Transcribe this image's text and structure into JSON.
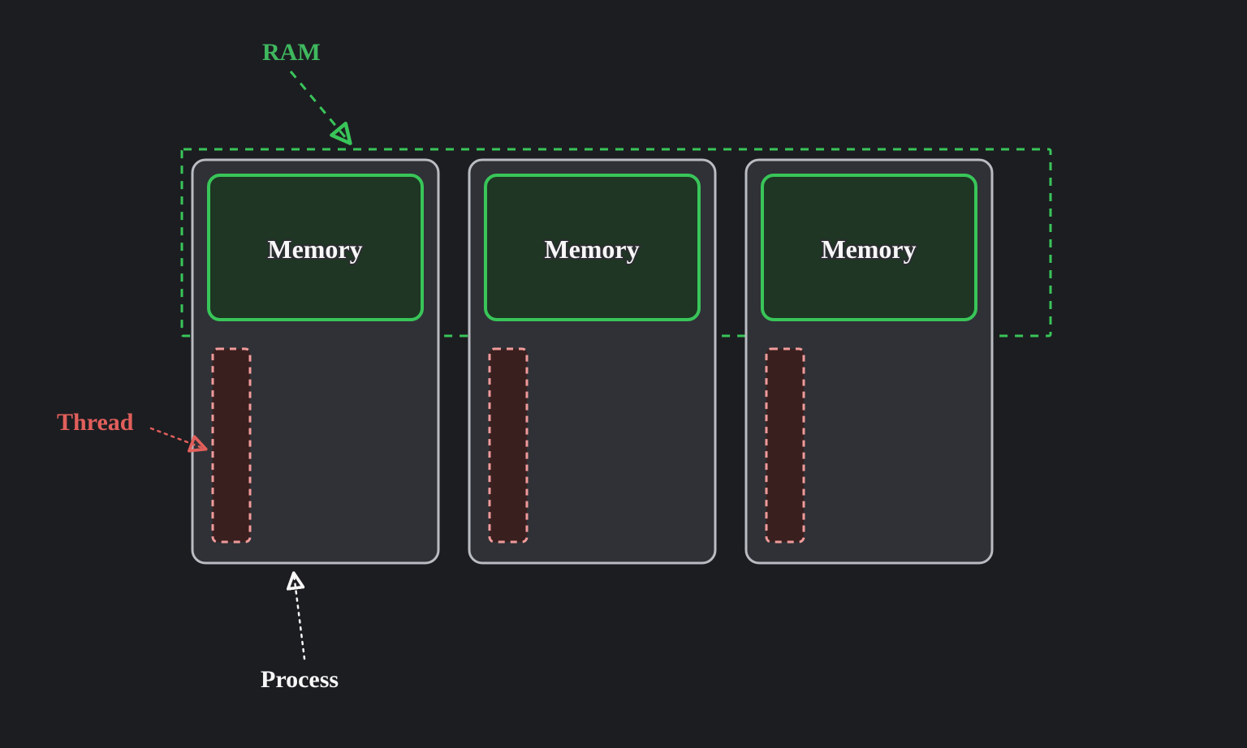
{
  "colors": {
    "bg": "#1c1d21",
    "processFill": "#2f3136",
    "processStroke": "#b9bcc2",
    "memoryFill": "#1e3623",
    "memoryStroke": "#39c559",
    "threadFill": "#3a1f1f",
    "threadStroke": "#f09a9a",
    "ramStroke": "#39c559",
    "ramLabel": "#3fb85e",
    "threadLabel": "#e15f5b",
    "processLabel": "#f7f7f7",
    "memoryLabel": "#f7f7f7"
  },
  "labels": {
    "ram": "RAM",
    "thread": "Thread",
    "process": "Process",
    "memory": "Memory"
  },
  "chart_data": {
    "type": "diagram",
    "description": "Each OS process has its own private Memory region (collectively residing in RAM) and at least one Thread.",
    "entities": [
      {
        "name": "RAM",
        "contains": [
          "Process.Memory"
        ]
      },
      {
        "name": "Process",
        "count": 3,
        "contains": [
          "Memory",
          "Thread"
        ]
      },
      {
        "name": "Memory",
        "per_process": 1
      },
      {
        "name": "Thread",
        "per_process": 1
      }
    ],
    "annotations": [
      {
        "label": "RAM",
        "points_to": "dashed green bounding box around all Memory blocks"
      },
      {
        "label": "Thread",
        "points_to": "dashed red bar inside first Process"
      },
      {
        "label": "Process",
        "points_to": "first grey Process container"
      }
    ]
  }
}
